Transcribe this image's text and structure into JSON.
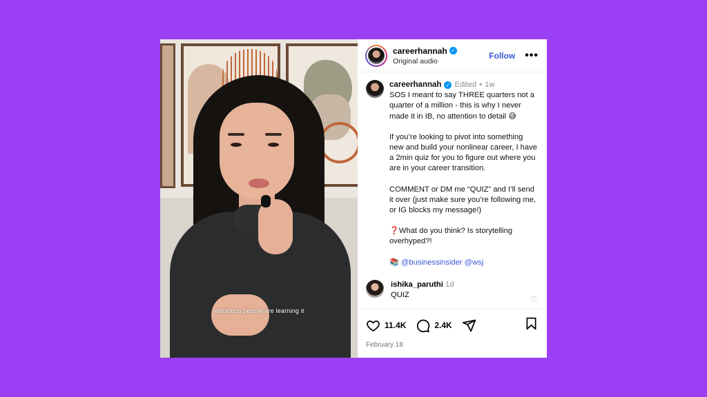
{
  "header": {
    "username": "careerhannah",
    "subtitle": "Original audio",
    "follow_label": "Follow",
    "more_label": "•••"
  },
  "video": {
    "caption_overlay": "ambitious people are learning it"
  },
  "post": {
    "username": "careerhannah",
    "edited_label": "Edited",
    "separator": "•",
    "age": "1w",
    "paragraphs": [
      "SOS I meant to say THREE quarters not a quarter of a million - this is why I never made it in IB, no attention to detail 😅",
      "If you’re looking to pivot into something new and build your nonlinear career, I have a 2min quiz for you to figure out where you are in your career transition.",
      "COMMENT or DM me “QUIZ” and I’ll send it over (just make sure you’re following me, or IG blocks my message!)",
      "❓What do you think? Is storytelling overhyped?!"
    ],
    "mentions_emoji": "📚",
    "mentions": "@businessinsider @wsj"
  },
  "comment": {
    "username": "ishika_paruthi",
    "age": "1d",
    "text": "QUIZ"
  },
  "actions": {
    "likes": "11.4K",
    "comments": "2.4K",
    "date": "February 18"
  },
  "colors": {
    "background": "#9b3ff5",
    "link": "#3a57d6",
    "verified": "#0095f6"
  }
}
